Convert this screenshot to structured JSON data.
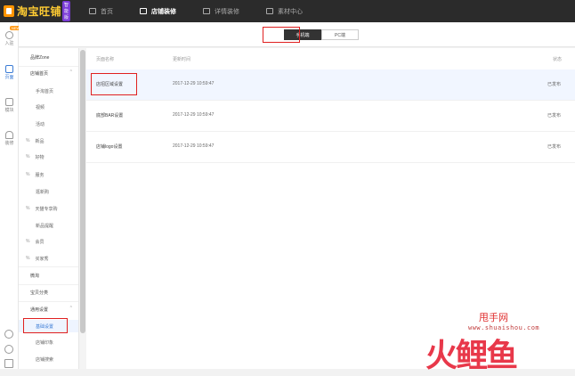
{
  "app": {
    "logo_text": "淘宝旺铺",
    "logo_badge": "智能版"
  },
  "top_nav": [
    {
      "label": "首页",
      "icon": "home-icon"
    },
    {
      "label": "店铺装修",
      "icon": "store-icon",
      "active": true
    },
    {
      "label": "详情装修",
      "icon": "list-icon"
    },
    {
      "label": "素材中心",
      "icon": "folder-icon"
    }
  ],
  "left_rail": {
    "badge": "NEW",
    "items": [
      {
        "label": "入驻",
        "icon": "user-icon"
      },
      {
        "label": "页面",
        "icon": "page-icon",
        "active": true
      },
      {
        "label": "模块",
        "icon": "module-icon"
      },
      {
        "label": "装修",
        "icon": "bag-icon"
      }
    ],
    "bottom_icons": [
      "help-icon",
      "headset-icon",
      "edit-icon"
    ]
  },
  "device_toggle": {
    "mobile": "手机端",
    "pc": "PC端",
    "active": "mobile"
  },
  "sidebar": {
    "items": [
      {
        "label": "品牌Zone",
        "kind": "group"
      },
      {
        "label": "店铺首页",
        "kind": "group",
        "expand": true
      },
      {
        "label": "手淘首页",
        "kind": "sub"
      },
      {
        "label": "视频",
        "kind": "sub"
      },
      {
        "label": "活动",
        "kind": "sub"
      },
      {
        "label": "新品",
        "kind": "sub",
        "prefix": "%"
      },
      {
        "label": "好物",
        "kind": "sub",
        "prefix": "%"
      },
      {
        "label": "服务",
        "kind": "sub",
        "prefix": "%"
      },
      {
        "label": "逛新购",
        "kind": "sub"
      },
      {
        "label": "天猫专享购",
        "kind": "sub",
        "prefix": "%"
      },
      {
        "label": "新品提醒",
        "kind": "sub"
      },
      {
        "label": "会员",
        "kind": "sub",
        "prefix": "%"
      },
      {
        "label": "买家秀",
        "kind": "sub",
        "prefix": "%"
      },
      {
        "label": "微淘",
        "kind": "group"
      },
      {
        "label": "宝贝分类",
        "kind": "group"
      },
      {
        "label": "通用设置",
        "kind": "group",
        "expand": true
      },
      {
        "label": "基础设置",
        "kind": "sub",
        "selected": true
      },
      {
        "label": "店铺印象",
        "kind": "sub"
      },
      {
        "label": "店铺搜索",
        "kind": "sub"
      }
    ]
  },
  "table": {
    "columns": {
      "name": "页面名称",
      "updated": "更新时间",
      "status": "状态"
    },
    "rows": [
      {
        "name": "店招区域设置",
        "updated": "2017-12-29 10:59:47",
        "status": "已发布"
      },
      {
        "name": "底部BAR设置",
        "updated": "2017-12-29 10:59:47",
        "status": "已发布"
      },
      {
        "name": "店铺logo设置",
        "updated": "2017-12-29 10:59:47",
        "status": "已发布"
      }
    ]
  },
  "watermark": {
    "top": "甩手网",
    "url": "www.shuaishou.com",
    "big": "火鲤鱼"
  },
  "colors": {
    "topbar": "#2b2b2b",
    "accent": "#3a7bd5",
    "highlight": "#e02020"
  }
}
